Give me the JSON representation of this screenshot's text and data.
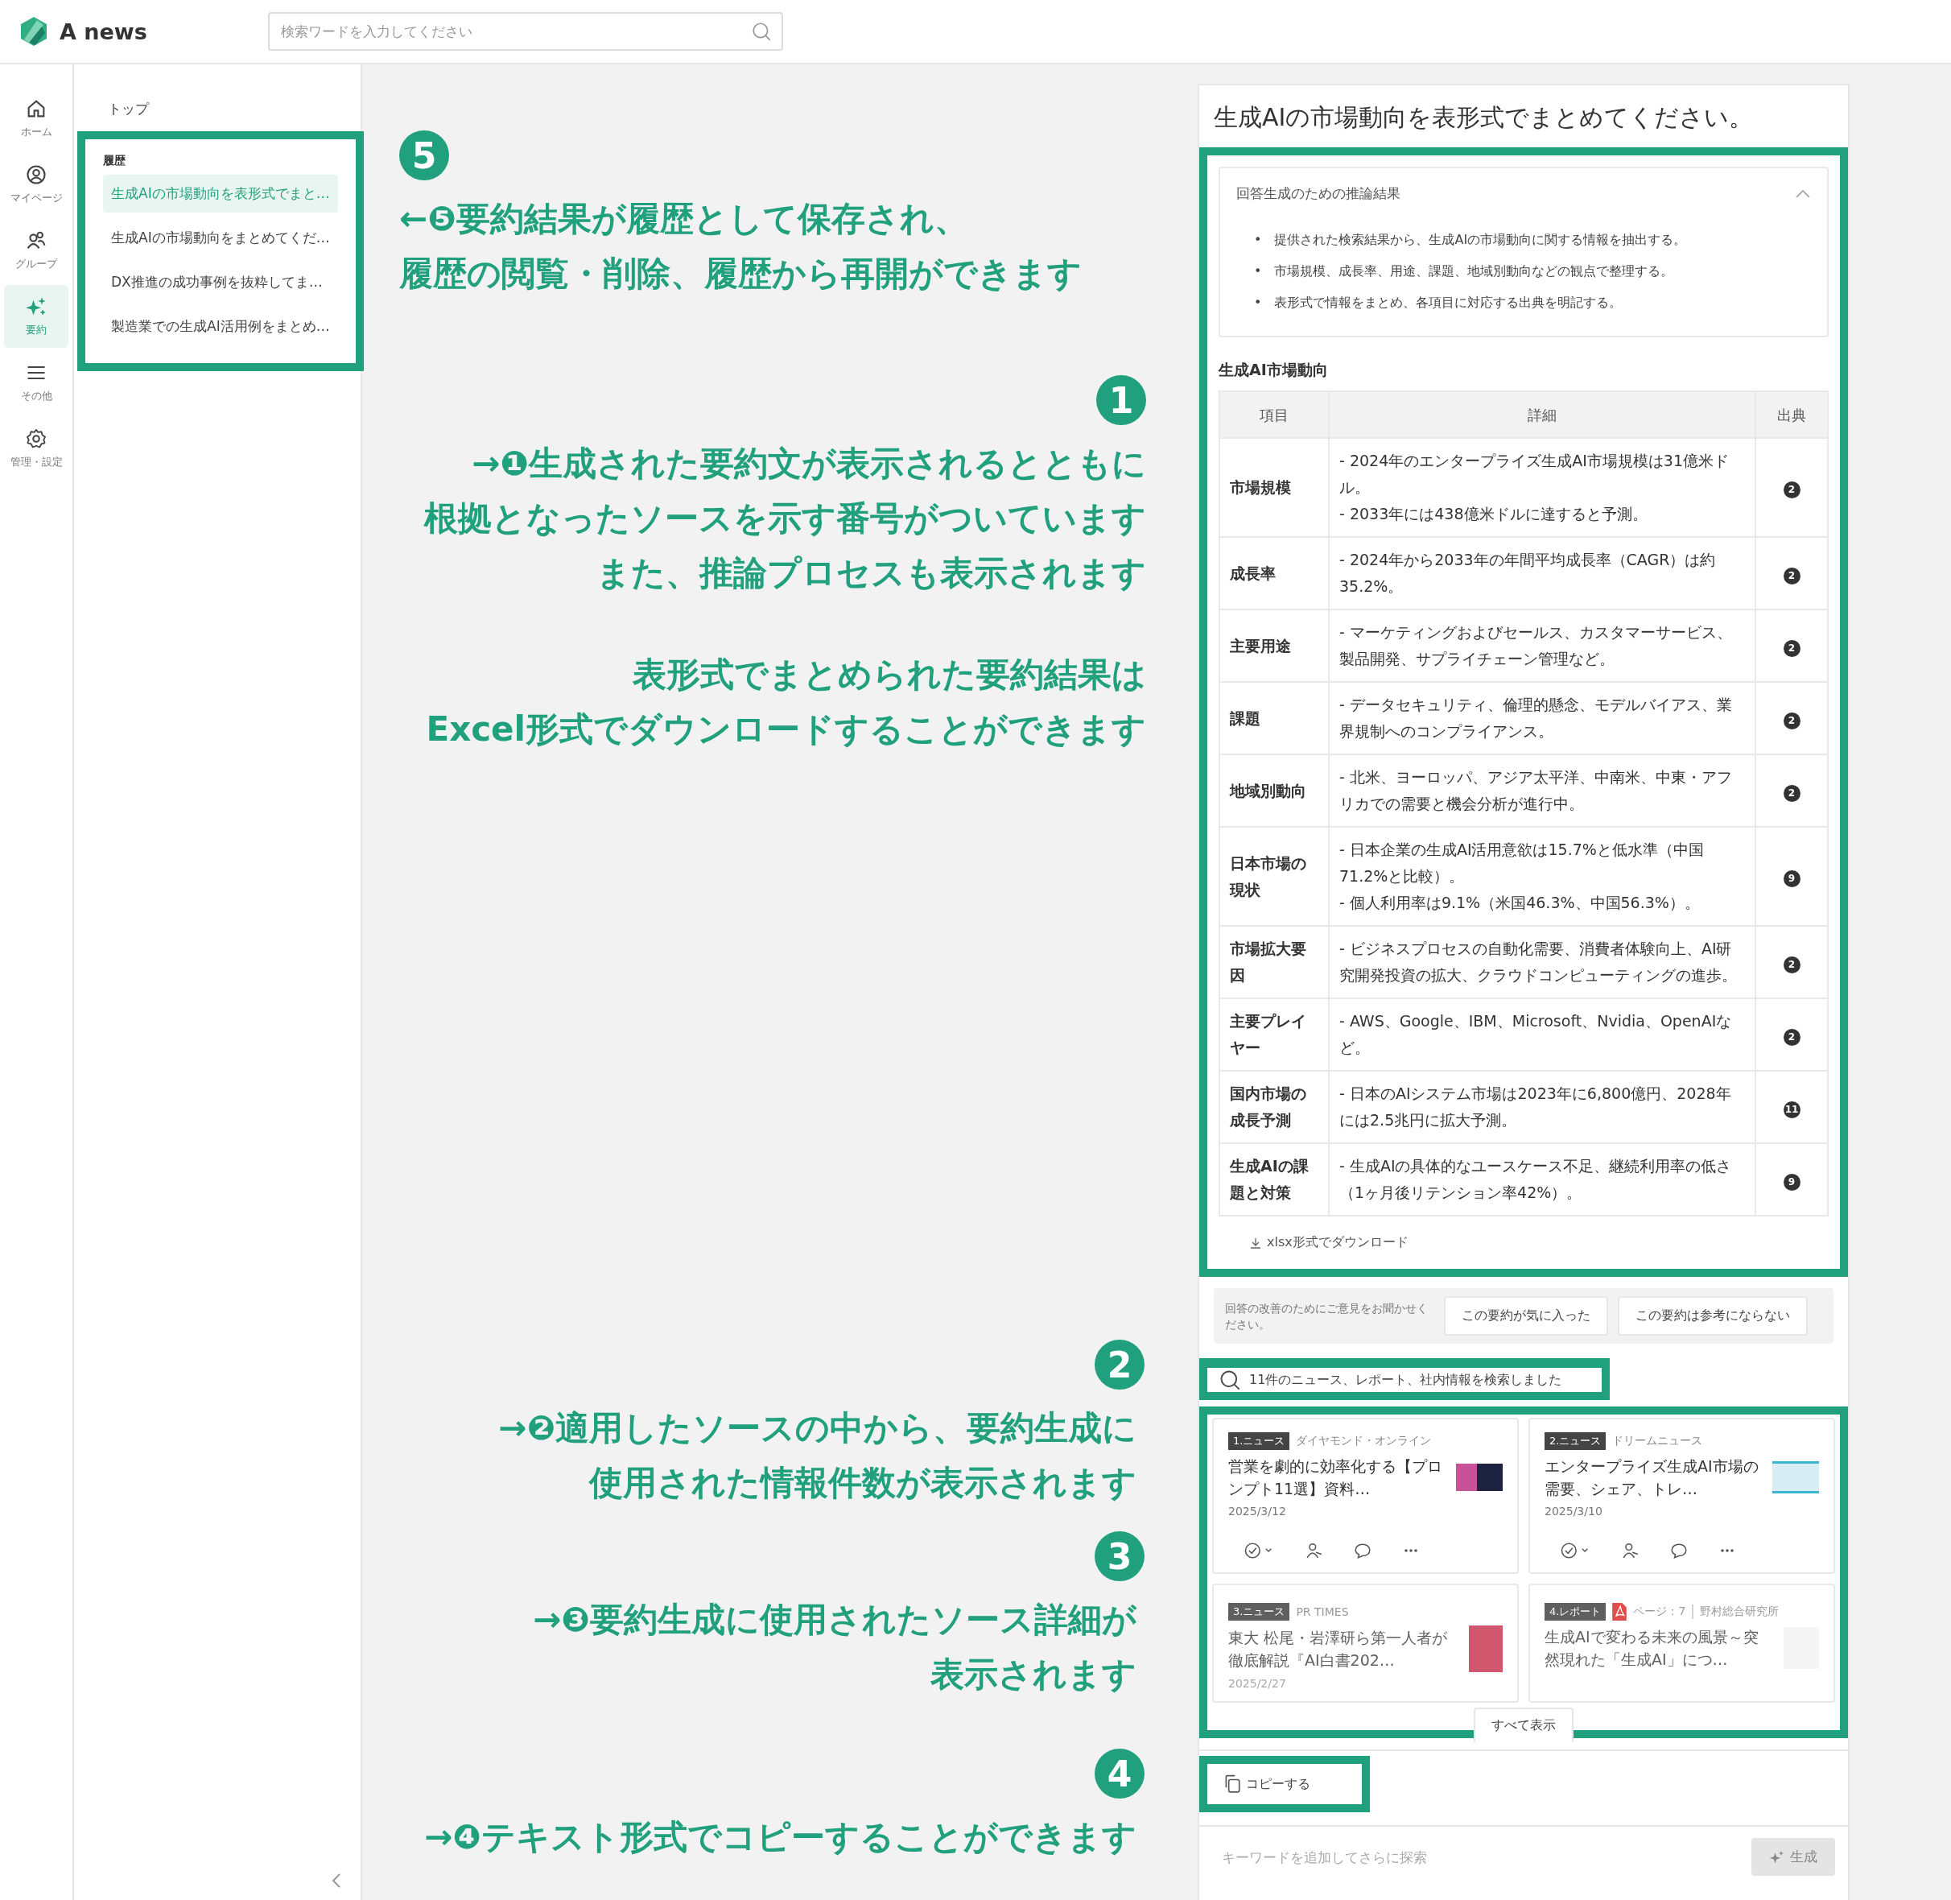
{
  "header": {
    "logo": "A news",
    "search": {
      "placeholder": "検索ワードを入力してください"
    }
  },
  "rail": [
    {
      "label": "ホーム",
      "selected": false
    },
    {
      "label": "マイページ",
      "selected": false
    },
    {
      "label": "グループ",
      "selected": false
    },
    {
      "label": "要約",
      "selected": true
    },
    {
      "label": "その他",
      "selected": false
    },
    {
      "label": "管理・設定",
      "selected": false
    }
  ],
  "sidebar": {
    "breadcrumb": "トップ",
    "history": {
      "title": "履歴",
      "items": [
        {
          "label": "生成AIの市場動向を表形式でまと…",
          "selected": true
        },
        {
          "label": "生成AIの市場動向をまとめてくだ…",
          "selected": false
        },
        {
          "label": "DX推進の成功事例を抜粋してま…",
          "selected": false
        },
        {
          "label": "製造業での生成AI活用例をまとめ…",
          "selected": false
        }
      ]
    }
  },
  "annotations": [
    {
      "number": "5",
      "paragraphs": [
        [
          "←❺要約結果が履歴として保存され、",
          "履歴の閲覧・削除、履歴から再開ができます"
        ]
      ]
    },
    {
      "number": "1",
      "paragraphs": [
        [
          "→❶生成された要約文が表示されるとともに",
          "根拠となったソースを示す番号がついています",
          "また、推論プロセスも表示されます"
        ],
        [
          "表形式でまとめられた要約結果は",
          "Excel形式でダウンロードすることができます"
        ]
      ]
    },
    {
      "number": "2",
      "paragraphs": [
        [
          "→❷適用したソースの中から、要約生成に",
          "使用された情報件数が表示されます"
        ]
      ]
    },
    {
      "number": "3",
      "paragraphs": [
        [
          "→❸要約生成に使用されたソース詳細が",
          "表示されます"
        ]
      ]
    },
    {
      "number": "4",
      "paragraphs": [
        [
          "→❹テキスト形式でコピーすることができます"
        ]
      ]
    }
  ],
  "panel": {
    "question": "生成AIの市場動向を表形式でまとめてください。",
    "reasoning": {
      "title": "回答生成のための推論結果",
      "expanded": true,
      "marker": "•",
      "items": [
        "提供された検索結果から、生成AIの市場動向に関する情報を抽出する。",
        "市場規模、成長率、用途、課題、地域別動向などの観点で整理する。",
        "表形式で情報をまとめ、各項目に対応する出典を明記する。"
      ]
    },
    "table_title": "生成AI市場動向",
    "table": {
      "columns": [
        "項目",
        "詳細",
        "出典"
      ],
      "rows": [
        {
          "item": "市場規模",
          "detail": "- 2024年のエンタープライズ生成AI市場規模は31億米ドル。\n- 2033年には438億米ドルに達すると予測。",
          "source": "2"
        },
        {
          "item": "成長率",
          "detail": "- 2024年から2033年の年間平均成長率（CAGR）は約35.2%。",
          "source": "2"
        },
        {
          "item": "主要用途",
          "detail": "- マーケティングおよびセールス、カスタマーサービス、製品開発、サプライチェーン管理など。",
          "source": "2"
        },
        {
          "item": "課題",
          "detail": "- データセキュリティ、倫理的懸念、モデルバイアス、業界規制へのコンプライアンス。",
          "source": "2"
        },
        {
          "item": "地域別動向",
          "detail": "- 北米、ヨーロッパ、アジア太平洋、中南米、中東・アフリカでの需要と機会分析が進行中。",
          "source": "2"
        },
        {
          "item": "日本市場の現状",
          "detail": "- 日本企業の生成AI活用意欲は15.7%と低水準（中国71.2%と比較）。\n- 個人利用率は9.1%（米国46.3%、中国56.3%）。",
          "source": "9"
        },
        {
          "item": "市場拡大要因",
          "detail": "- ビジネスプロセスの自動化需要、消費者体験向上、AI研究開発投資の拡大、クラウドコンピューティングの進歩。",
          "source": "2"
        },
        {
          "item": "主要プレイヤー",
          "detail": "- AWS、Google、IBM、Microsoft、Nvidia、OpenAIなど。",
          "source": "2"
        },
        {
          "item": "国内市場の成長予測",
          "detail": "- 日本のAIシステム市場は2023年に6,800億円、2028年には2.5兆円に拡大予測。",
          "source": "11"
        },
        {
          "item": "生成AIの課題と対策",
          "detail": "- 生成AIの具体的なユースケース不足、継続利用率の低さ（1ヶ月後リテンション率42%）。",
          "source": "9"
        }
      ]
    },
    "download": "xlsx形式でダウンロード",
    "feedback": {
      "prompt": "回答の改善のためにご意見をお聞かせください。",
      "buttons": [
        "この要約が気に入った",
        "この要約は参考にならない"
      ]
    },
    "search_count": "11件のニュース、レポート、社内情報を検索しました",
    "sources": [
      {
        "kind": "news",
        "tag": "1.ニュース",
        "source": "ダイヤモンド・オンライン",
        "title": "営業を劇的に効率化する【プロンプト11選】資料…",
        "date": "2025/3/12",
        "truncated": false
      },
      {
        "kind": "news",
        "tag": "2.ニュース",
        "source": "ドリームニュース",
        "title": "エンタープライズ生成AI市場の需要、シェア、トレ…",
        "date": "2025/3/10",
        "truncated": false
      },
      {
        "kind": "news",
        "tag": "3.ニュース",
        "source": "PR TIMES",
        "title": "東大 松尾・岩澤研ら第一人者が徹底解説『AI白書202…",
        "date": "2025/2/27",
        "truncated": true
      },
      {
        "kind": "report",
        "tag": "4.レポート",
        "page": "ページ：7",
        "source": "野村総合研究所",
        "title": "生成AIで変わる未来の風景～突然現れた「生成AI」につ…",
        "truncated": true
      }
    ],
    "show_all": "すべて表示",
    "copy": "コピーする",
    "followup": {
      "placeholder": "キーワードを追加してさらに探索",
      "button": "生成",
      "disabled": true
    }
  }
}
